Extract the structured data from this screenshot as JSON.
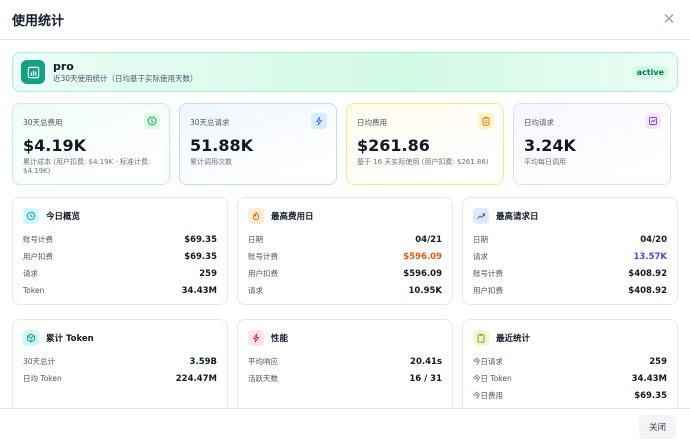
{
  "modal": {
    "title": "使用统计",
    "close_label": "关闭"
  },
  "plan": {
    "name": "pro",
    "subtitle": "近30天使用统计（日均基于实际使用天数）",
    "status": "active"
  },
  "stats": [
    {
      "label": "30天总费用",
      "value": "$4.19K",
      "sub": "累计成本 (用户扣费: $4.19K · 标准计费: $4.19K)",
      "icon": "dollar-icon",
      "color": "#16a34a"
    },
    {
      "label": "30天总请求",
      "value": "51.88K",
      "sub": "累计调用次数",
      "icon": "bolt-icon",
      "color": "#3b82f6"
    },
    {
      "label": "日均费用",
      "value": "$261.86",
      "sub": "基于 16 天实际使用 (用户扣费: $261.86)",
      "icon": "clipboard-icon",
      "color": "#d97706"
    },
    {
      "label": "日均请求",
      "value": "3.24K",
      "sub": "平均每日调用",
      "icon": "chart-icon",
      "color": "#9333ea"
    }
  ],
  "cards": {
    "today": {
      "title": "今日概览",
      "rows": [
        {
          "k": "账号计费",
          "v": "$69.35"
        },
        {
          "k": "用户扣费",
          "v": "$69.35"
        },
        {
          "k": "请求",
          "v": "259"
        },
        {
          "k": "Token",
          "v": "34.43M"
        }
      ]
    },
    "top_cost_day": {
      "title": "最高费用日",
      "rows": [
        {
          "k": "日期",
          "v": "04/21"
        },
        {
          "k": "账号计费",
          "v": "$596.09"
        },
        {
          "k": "用户扣费",
          "v": "$596.09"
        },
        {
          "k": "请求",
          "v": "10.95K"
        }
      ]
    },
    "top_request_day": {
      "title": "最高请求日",
      "rows": [
        {
          "k": "日期",
          "v": "04/20"
        },
        {
          "k": "请求",
          "v": "13.57K"
        },
        {
          "k": "账号计费",
          "v": "$408.92"
        },
        {
          "k": "用户扣费",
          "v": "$408.92"
        }
      ]
    },
    "tokens": {
      "title": "累计 Token",
      "rows": [
        {
          "k": "30天总计",
          "v": "3.59B"
        },
        {
          "k": "日均 Token",
          "v": "224.47M"
        }
      ]
    },
    "performance": {
      "title": "性能",
      "rows": [
        {
          "k": "平均响应",
          "v": "20.41s"
        },
        {
          "k": "活跃天数",
          "v": "16 / 31"
        }
      ]
    },
    "recent": {
      "title": "最近统计",
      "rows": [
        {
          "k": "今日请求",
          "v": "259"
        },
        {
          "k": "今日 Token",
          "v": "34.43M"
        },
        {
          "k": "今日费用",
          "v": "$69.35"
        }
      ]
    }
  }
}
